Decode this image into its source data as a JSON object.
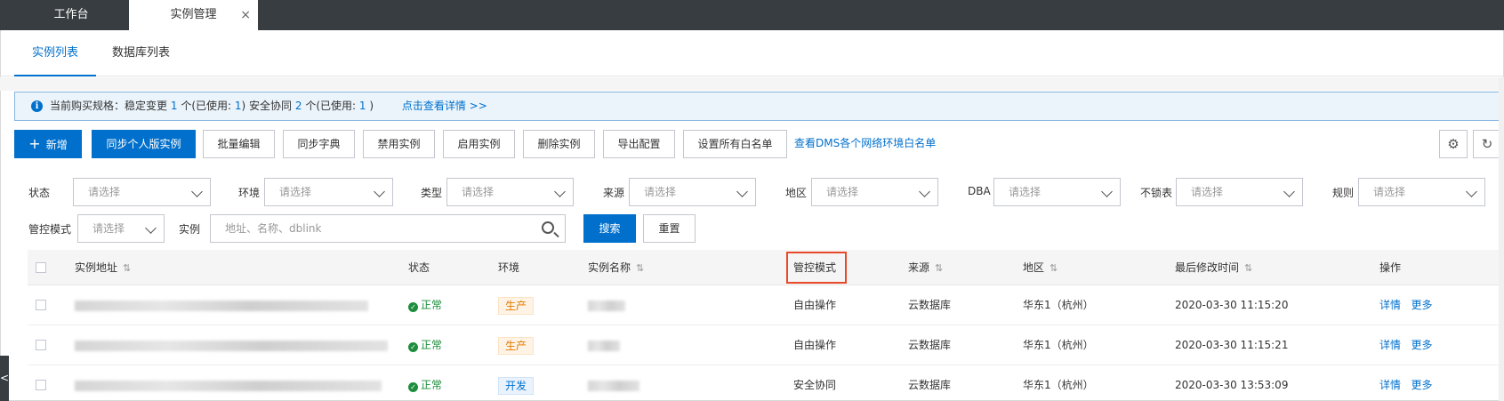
{
  "window_tabs": [
    {
      "label": "工作台"
    },
    {
      "label": "实例管理",
      "close": "×"
    }
  ],
  "sub_tabs": [
    {
      "label": "实例列表"
    },
    {
      "label": "数据库列表"
    }
  ],
  "info": {
    "icon": "i",
    "prefix": "当前购买规格：稳定变更",
    "stable_count": "1",
    "mid1": "个(已使用:",
    "stable_used": "1",
    "mid2": ")  安全协同",
    "secure_count": "2",
    "mid3": "个(已使用:",
    "secure_used": "1",
    "suffix": ")",
    "link": "点击查看详情 >>"
  },
  "toolbar": {
    "add_icon": "+",
    "add": "新增",
    "sync": "同步个人版实例",
    "batch_edit": "批量编辑",
    "sync_dict": "同步字典",
    "disable": "禁用实例",
    "enable": "启用实例",
    "delete": "删除实例",
    "export": "导出配置",
    "whitelist": "设置所有白名单",
    "view_whitelist": "查看DMS各个网络环境白名单",
    "settings_icon": "⚙",
    "refresh_icon": "↻"
  },
  "filters": {
    "placeholder": "请选择",
    "labels": {
      "status": "状态",
      "env": "环境",
      "type": "类型",
      "source": "来源",
      "region": "地区",
      "dba": "DBA",
      "nolock": "不锁表",
      "rule": "规则",
      "mode": "管控模式",
      "instance": "实例"
    },
    "instance_placeholder": "地址、名称、dblink",
    "search": "搜索",
    "reset": "重置"
  },
  "table": {
    "sort_glyph": "⇅",
    "columns": {
      "addr": "实例地址",
      "status": "状态",
      "env": "环境",
      "name": "实例名称",
      "mode": "管控模式",
      "source": "来源",
      "region": "地区",
      "modified": "最后修改时间",
      "ops": "操作"
    },
    "rows": [
      {
        "status": "正常",
        "env": "生产",
        "mode": "自由操作",
        "source": "云数据库",
        "region": "华东1（杭州）",
        "modified": "2020-03-30 11:15:20",
        "detail": "详情",
        "more": "更多"
      },
      {
        "status": "正常",
        "env": "生产",
        "mode": "自由操作",
        "source": "云数据库",
        "region": "华东1（杭州）",
        "modified": "2020-03-30 11:15:21",
        "detail": "详情",
        "more": "更多"
      },
      {
        "status": "正常",
        "env": "开发",
        "mode": "安全协同",
        "source": "云数据库",
        "region": "华东1（杭州）",
        "modified": "2020-03-30 13:53:09",
        "detail": "详情",
        "more": "更多"
      }
    ]
  },
  "status_icon": "✓",
  "side_handle": "<",
  "colors": {
    "accent": "#0070cc",
    "tabbar": "#373d41",
    "highlight": "#e8492a",
    "ok": "#1e8e3e",
    "prod_tag": "#e07a00"
  }
}
